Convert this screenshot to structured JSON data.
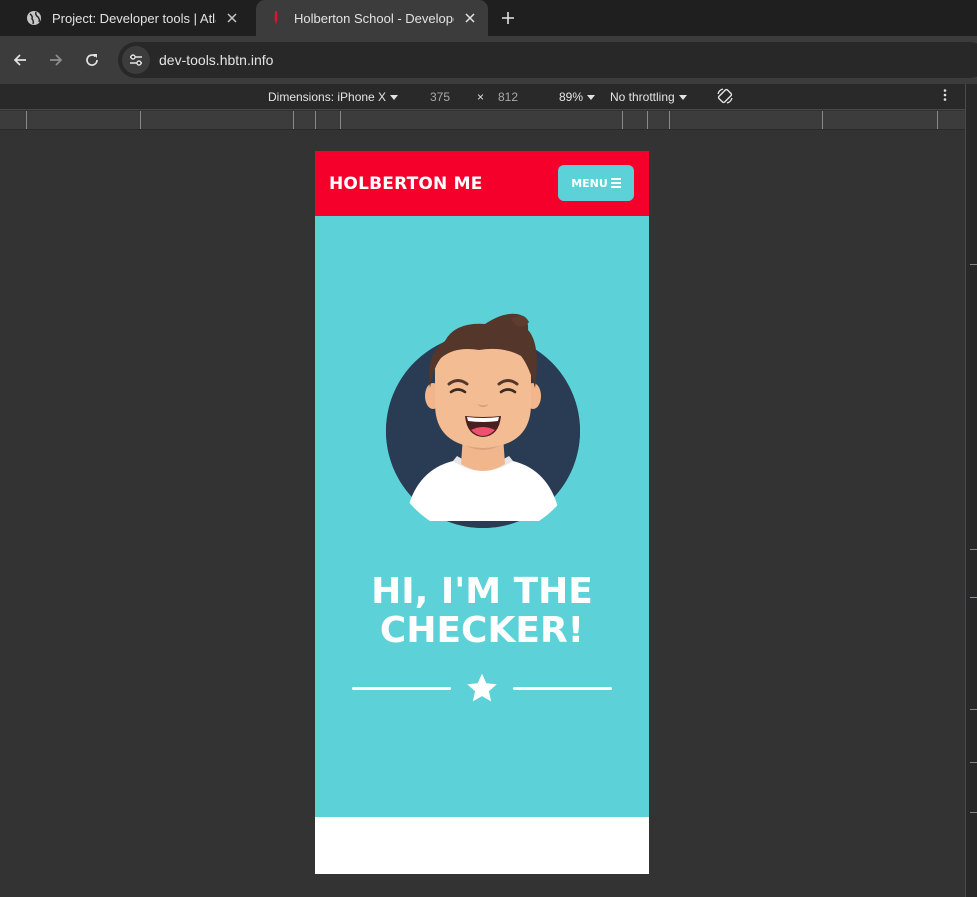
{
  "browser": {
    "tabs": [
      {
        "title": "Project: Developer tools | Atla",
        "active": false,
        "favicon": "globe-icon"
      },
      {
        "title": "Holberton School - Developer",
        "active": true,
        "favicon": "holberton-favicon"
      }
    ],
    "url": "dev-tools.hbtn.info"
  },
  "devtools": {
    "dimensions_label": "Dimensions: iPhone X",
    "width": "375",
    "times": "×",
    "height": "812",
    "zoom": "89%",
    "throttling": "No throttling"
  },
  "site": {
    "brand": "HOLBERTON ME",
    "menu_label": "MENU",
    "headline_line1": "HI, I'M THE",
    "headline_line2": "CHECKER!",
    "colors": {
      "header": "#f4002a",
      "hero": "#5cd1d8",
      "avatar_circle": "#2a3c53"
    }
  }
}
